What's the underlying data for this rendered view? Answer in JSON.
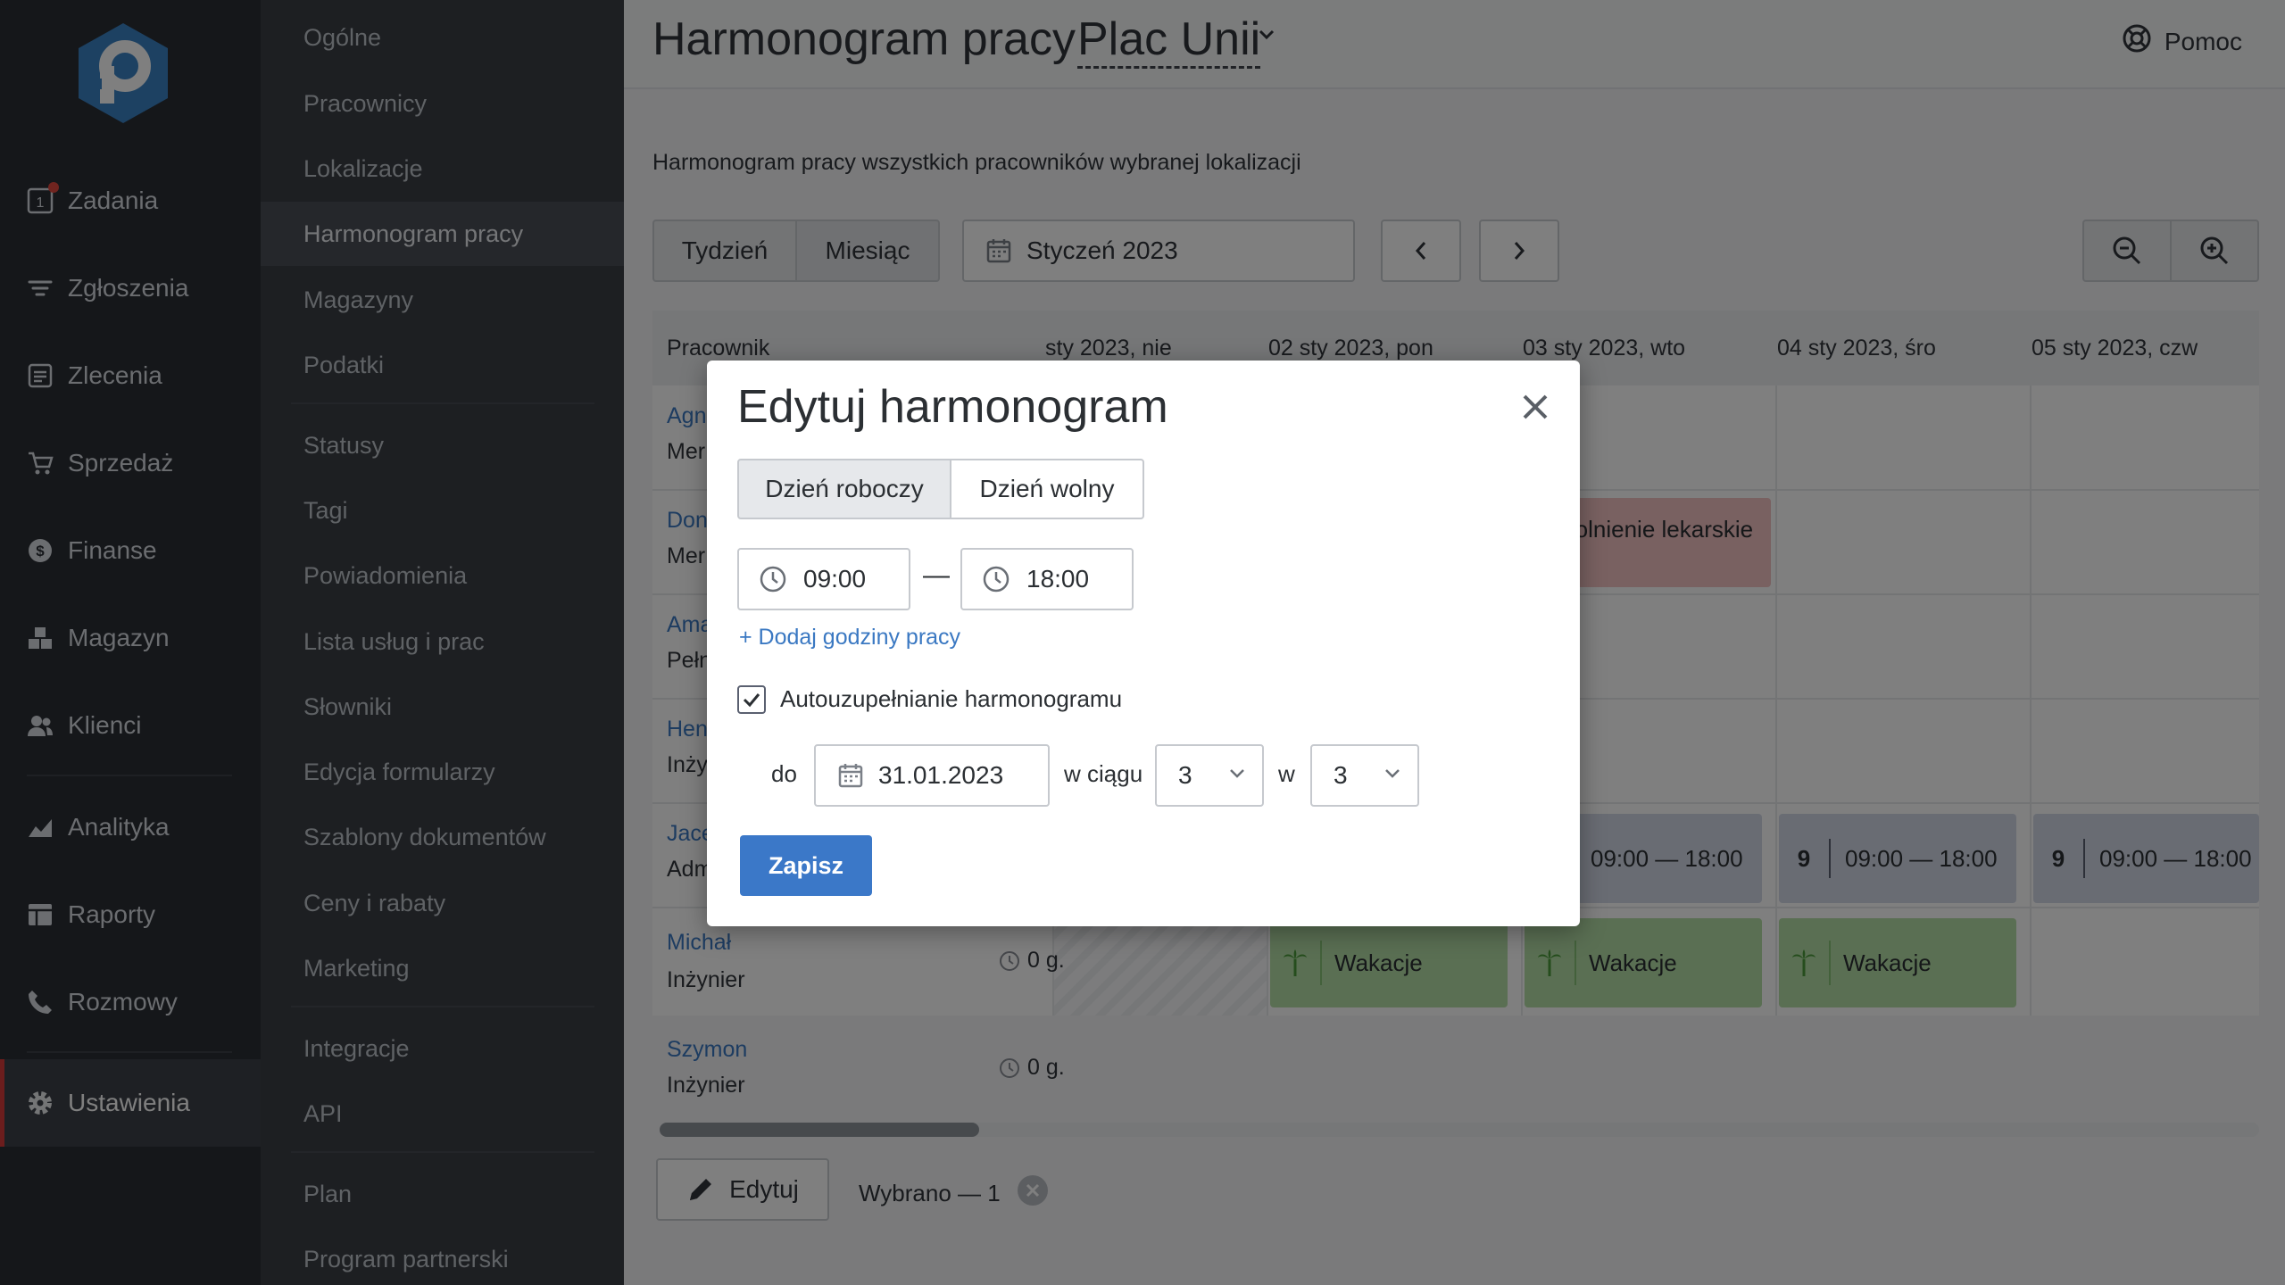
{
  "rail": {
    "items": [
      {
        "label": "Zadania",
        "icon": "tasks-icon",
        "badge_dot": true
      },
      {
        "label": "Zgłoszenia",
        "icon": "filter-icon"
      },
      {
        "label": "Zlecenia",
        "icon": "orders-icon"
      },
      {
        "label": "Sprzedaż",
        "icon": "cart-icon"
      },
      {
        "label": "Finanse",
        "icon": "dollar-icon"
      },
      {
        "label": "Magazyn",
        "icon": "boxes-icon"
      },
      {
        "label": "Klienci",
        "icon": "users-icon"
      },
      {
        "label": "Analityka",
        "icon": "chart-icon"
      },
      {
        "label": "Raporty",
        "icon": "reports-icon"
      },
      {
        "label": "Rozmowy",
        "icon": "phone-icon"
      },
      {
        "label": "Ustawienia",
        "icon": "gear-icon",
        "active": true
      }
    ],
    "zadania_count": "1"
  },
  "subnav": {
    "items": [
      "Ogólne",
      "Pracownicy",
      "Lokalizacje",
      "Harmonogram pracy",
      "Magazyny",
      "Podatki",
      "Statusy",
      "Tagi",
      "Powiadomienia",
      "Lista usług i prac",
      "Słowniki",
      "Edycja formularzy",
      "Szablony dokumentów",
      "Ceny i rabaty",
      "Marketing",
      "Integracje",
      "API",
      "Plan",
      "Program partnerski"
    ],
    "active": "Harmonogram pracy"
  },
  "header": {
    "title": "Harmonogram pracy",
    "location": "Plac Unii",
    "help": "Pomoc"
  },
  "subtitle": "Harmonogram pracy wszystkich pracowników wybranej lokalizacji",
  "toolbar": {
    "week": "Tydzień",
    "month": "Miesiąc",
    "period": "Styczeń 2023"
  },
  "grid": {
    "columns": [
      "Pracownik",
      "sty 2023, nie",
      "02 sty 2023, pon",
      "03 sty 2023, wto",
      "04 sty 2023, śro",
      "05 sty 2023, czw"
    ],
    "employees": [
      {
        "name": "Agn",
        "role": "Mer"
      },
      {
        "name": "Don",
        "role": "Mer"
      },
      {
        "name": "Ama",
        "role": "Pełn"
      },
      {
        "name": "Hen",
        "role": "Inży"
      },
      {
        "name": "Jace",
        "role": "Adm"
      },
      {
        "name": "Michał",
        "role": "Inżynier",
        "hours": "0 g."
      },
      {
        "name": "Szymon",
        "role": "Inżynier",
        "hours": "0 g."
      }
    ],
    "sick_leave": "Zwolnienie lekarskie",
    "shift_num": "9",
    "shift_time": "09:00 — 18:00",
    "vacation": "Wakacje"
  },
  "footer": {
    "edit": "Edytuj",
    "selected": "Wybrano — 1",
    "scroll_fraction": 0.2
  },
  "modal": {
    "title": "Edytuj harmonogram",
    "workday": "Dzień roboczy",
    "dayoff": "Dzień wolny",
    "start": "09:00",
    "dash": "—",
    "end": "18:00",
    "add_hours": "+ Dodaj godziny pracy",
    "autofill": "Autouzupełnianie harmonogramu",
    "autofill_checked": true,
    "until_label": "do",
    "until_date": "31.01.2023",
    "within_label": "w ciągu",
    "within_value": "3",
    "w_label": "w",
    "w_value": "3",
    "save": "Zapisz"
  },
  "colors": {
    "accent": "#3b78c8",
    "vacation": "#b4dfa6",
    "sick": "#f3c2c2",
    "shift": "#d2d9e7",
    "active_marker": "#d93a3a"
  }
}
